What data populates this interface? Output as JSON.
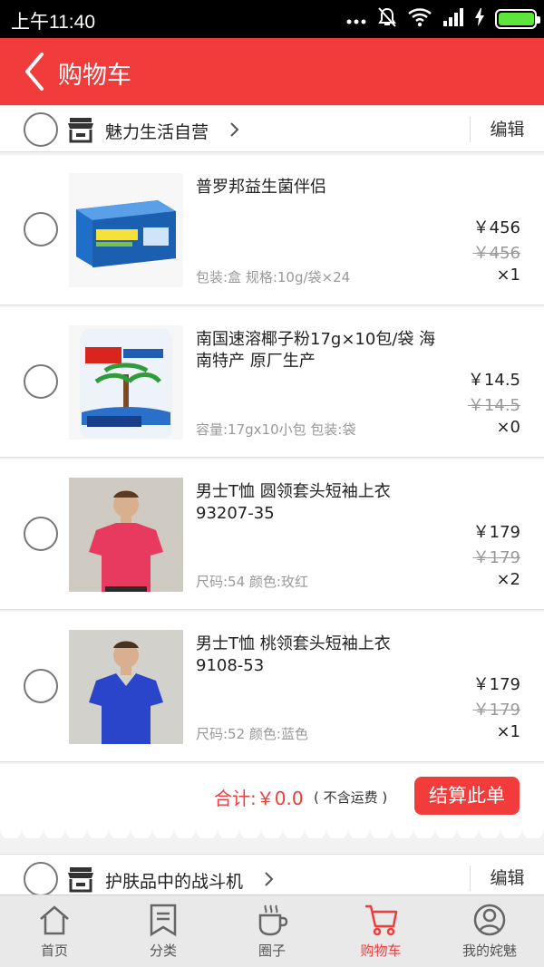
{
  "status_bar": {
    "time": "上午11:40"
  },
  "header": {
    "title": "购物车"
  },
  "shops": [
    {
      "name": "魅力生活自营",
      "edit_label": "编辑",
      "items": [
        {
          "name": "普罗邦益生菌伴侣",
          "spec": "包装:盒 规格:10g/袋×24",
          "price": "￥456",
          "old_price": "￥456",
          "qty": "×1"
        },
        {
          "name": "南国速溶椰子粉17g×10包/袋 海南特产 原厂生产",
          "spec": "容量:17gx10小包 包装:袋",
          "price": "￥14.5",
          "old_price": "￥14.5",
          "qty": "×0"
        },
        {
          "name": "男士T恤 圆领套头短袖上衣 93207-35",
          "spec": "尺码:54 颜色:玫红",
          "price": "￥179",
          "old_price": "￥179",
          "qty": "×2"
        },
        {
          "name": "男士T恤 桃领套头短袖上衣 9108-53",
          "spec": "尺码:52 颜色:蓝色",
          "price": "￥179",
          "old_price": "￥179",
          "qty": "×1"
        }
      ],
      "total_label": "合计:￥0.0",
      "total_note": "( 不含运费 )",
      "checkout_label": "结算此单"
    },
    {
      "name": "护肤品中的战斗机",
      "edit_label": "编辑"
    }
  ],
  "tabs": [
    {
      "label": "首页",
      "icon": "home-icon"
    },
    {
      "label": "分类",
      "icon": "bookmark-icon"
    },
    {
      "label": "圈子",
      "icon": "coffee-cup-icon"
    },
    {
      "label": "购物车",
      "icon": "cart-icon",
      "active": true
    },
    {
      "label": "我的姹魅",
      "icon": "user-icon"
    }
  ],
  "colors": {
    "brand": "#f23b3b",
    "tab_bg": "#e9e9e9"
  }
}
